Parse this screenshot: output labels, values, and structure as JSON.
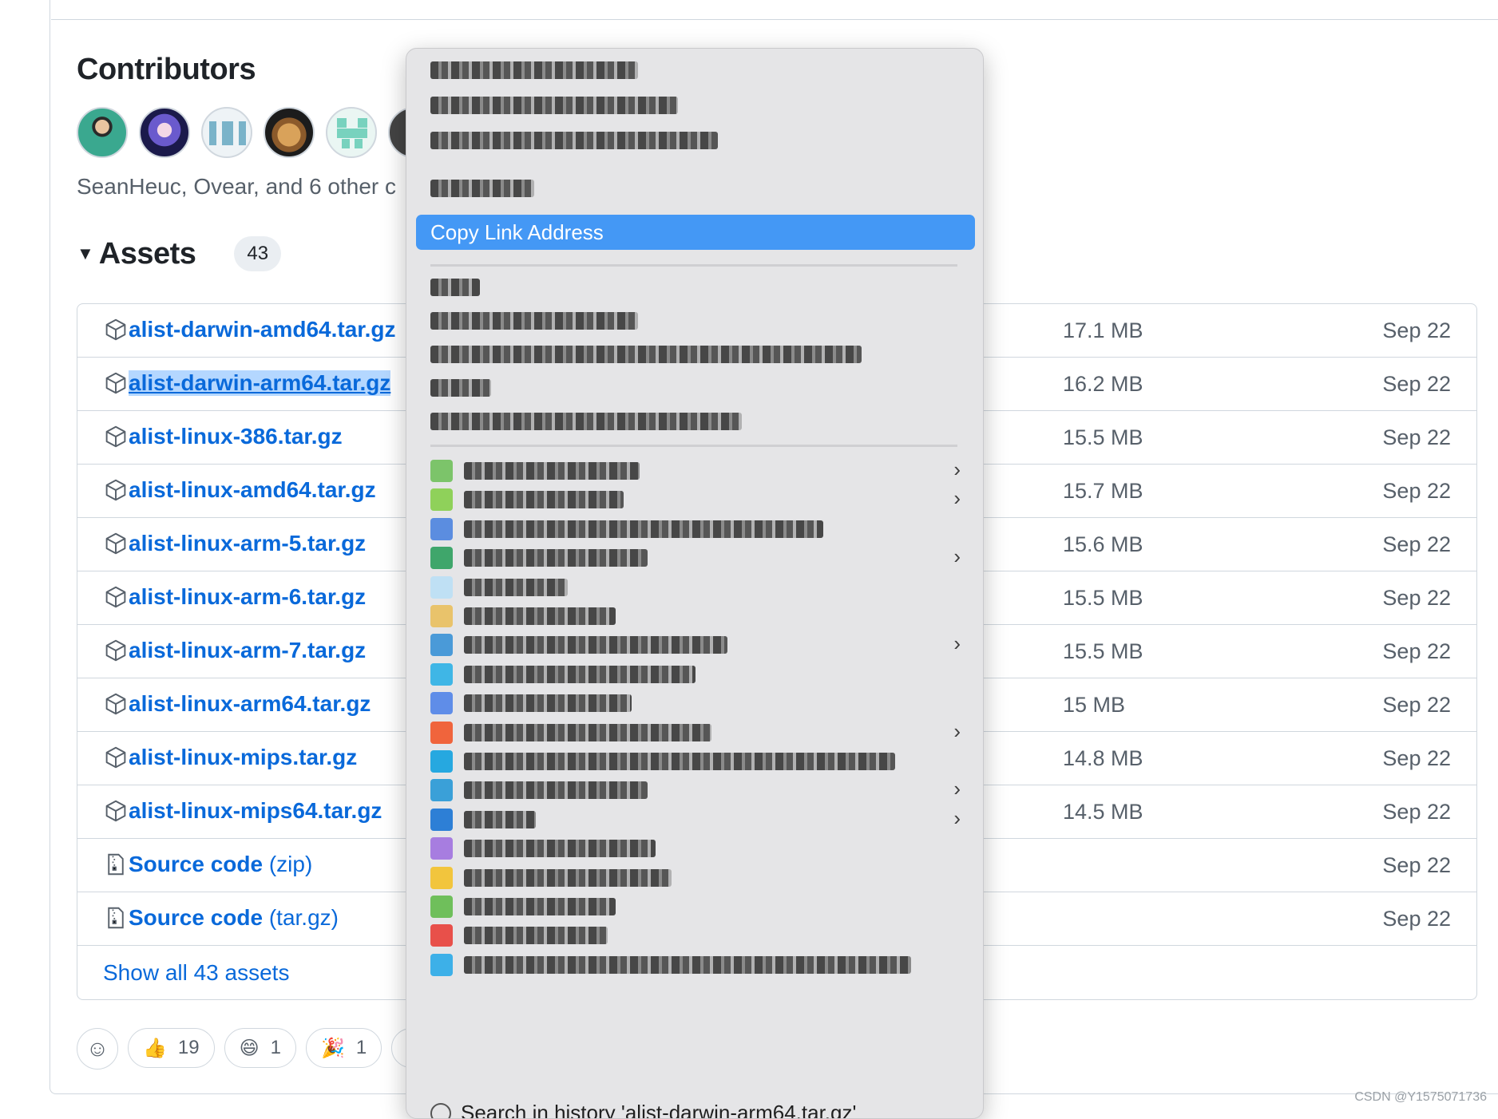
{
  "contributors": {
    "title": "Contributors",
    "summary": "SeanHeuc, Ovear, and 6 other c"
  },
  "assets": {
    "title": "Assets",
    "count": "43",
    "rows": [
      {
        "name": "alist-darwin-amd64.tar.gz",
        "size": "17.1 MB",
        "date": "Sep 22"
      },
      {
        "name": "alist-darwin-arm64.tar.gz",
        "size": "16.2 MB",
        "date": "Sep 22",
        "selected": true
      },
      {
        "name": "alist-linux-386.tar.gz",
        "size": "15.5 MB",
        "date": "Sep 22"
      },
      {
        "name": "alist-linux-amd64.tar.gz",
        "size": "15.7 MB",
        "date": "Sep 22"
      },
      {
        "name": "alist-linux-arm-5.tar.gz",
        "size": "15.6 MB",
        "date": "Sep 22"
      },
      {
        "name": "alist-linux-arm-6.tar.gz",
        "size": "15.5 MB",
        "date": "Sep 22"
      },
      {
        "name": "alist-linux-arm-7.tar.gz",
        "size": "15.5 MB",
        "date": "Sep 22"
      },
      {
        "name": "alist-linux-arm64.tar.gz",
        "size": "15 MB",
        "date": "Sep 22"
      },
      {
        "name": "alist-linux-mips.tar.gz",
        "size": "14.8 MB",
        "date": "Sep 22"
      },
      {
        "name": "alist-linux-mips64.tar.gz",
        "size": "14.5 MB",
        "date": "Sep 22"
      }
    ],
    "source_rows": [
      {
        "name": "Source code",
        "suffix": "(zip)",
        "date": "Sep 22"
      },
      {
        "name": "Source code",
        "suffix": "(tar.gz)",
        "date": "Sep 22"
      }
    ],
    "show_all": "Show all 43 assets"
  },
  "reactions": [
    {
      "emoji": "👍",
      "count": "19"
    },
    {
      "emoji": "😄",
      "count": "1"
    },
    {
      "emoji": "🎉",
      "count": "1"
    },
    {
      "emoji": "❤️",
      "count": ""
    }
  ],
  "context_menu": {
    "highlighted": "Copy Link Address",
    "last_item": "Search in history 'alist-darwin-arm64.tar.gz'",
    "icon_colors": [
      "#7cc46a",
      "#8fd15a",
      "#5b8de0",
      "#3fa66b",
      "#bfe0f4",
      "#e9c36b",
      "#4a9ad8",
      "#3fb6e6",
      "#5f8de8",
      "#f0643c",
      "#26a8e0",
      "#3aa0d8",
      "#2d7fd6",
      "#a77de0",
      "#f2c53d",
      "#6fbf5b",
      "#e8504a",
      "#3db0e8"
    ]
  },
  "watermark": "CSDN @Y1575071736"
}
